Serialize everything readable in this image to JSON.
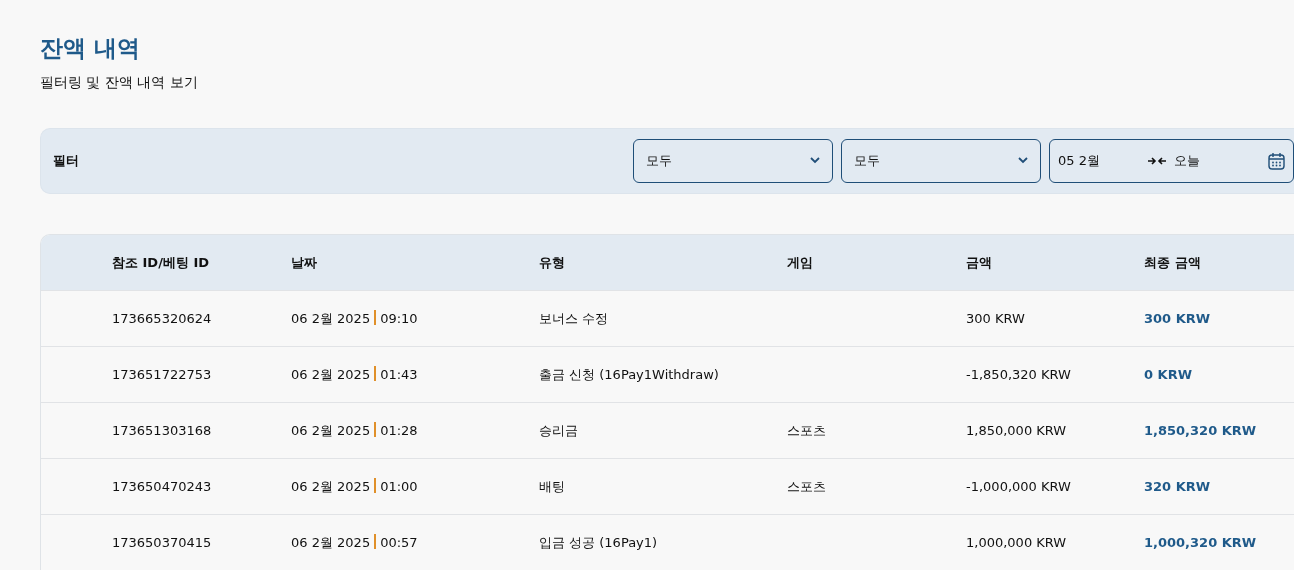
{
  "header": {
    "title": "잔액 내역",
    "subtitle": "필터링 및 잔액 내역 보기"
  },
  "filter": {
    "label": "필터",
    "selects": [
      {
        "value": "모두"
      },
      {
        "value": "모두"
      }
    ],
    "date_range": {
      "start": "05 2월",
      "end": "오늘"
    }
  },
  "table": {
    "columns": [
      "참조 ID/베팅 ID",
      "날짜",
      "유형",
      "게임",
      "금액",
      "최종 금액"
    ],
    "rows": [
      {
        "id": "173665320624",
        "date": "06 2월 2025",
        "time": "09:10",
        "type": "보너스 수정",
        "game": "",
        "amount": "300 KRW",
        "final": "300 KRW"
      },
      {
        "id": "173651722753",
        "date": "06 2월 2025",
        "time": "01:43",
        "type": "출금 신청 (16Pay1Withdraw)",
        "game": "",
        "amount": "-1,850,320 KRW",
        "final": "0 KRW"
      },
      {
        "id": "173651303168",
        "date": "06 2월 2025",
        "time": "01:28",
        "type": "승리금",
        "game": "스포츠",
        "amount": "1,850,000 KRW",
        "final": "1,850,320 KRW"
      },
      {
        "id": "173650470243",
        "date": "06 2월 2025",
        "time": "01:00",
        "type": "배팅",
        "game": "스포츠",
        "amount": "-1,000,000 KRW",
        "final": "320 KRW"
      },
      {
        "id": "173650370415",
        "date": "06 2월 2025",
        "time": "00:57",
        "type": "입금 성공 (16Pay1)",
        "game": "",
        "amount": "1,000,000 KRW",
        "final": "1,000,320 KRW"
      }
    ]
  }
}
